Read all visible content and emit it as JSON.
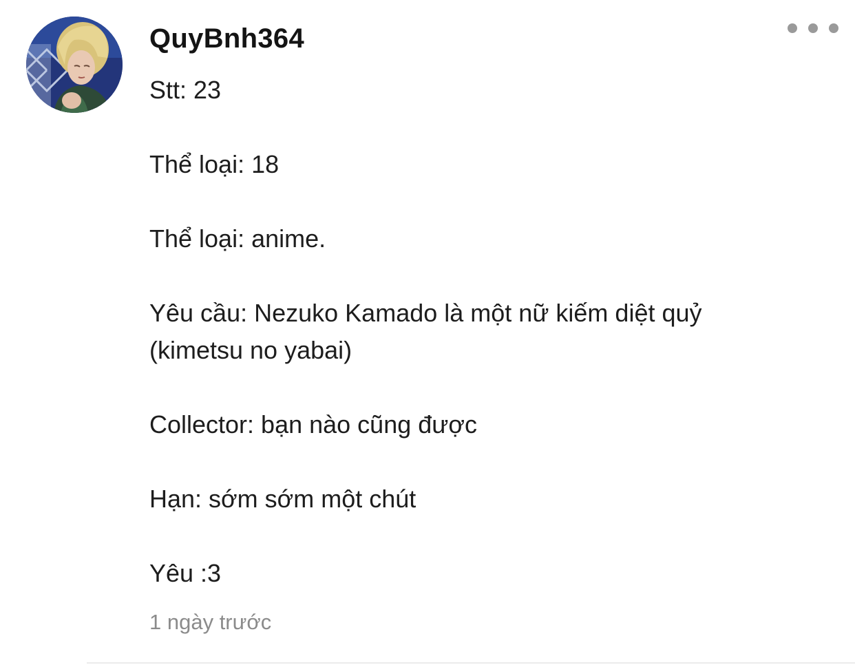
{
  "comment": {
    "username": "QuyBnh364",
    "avatar_icon": "user-avatar-anime-girl",
    "more_icon": "more-options-icon",
    "lines": [
      "Stt: 23",
      "Thể loại: 18",
      "Thể loại: anime.",
      "Yêu cầu: Nezuko Kamado là một nữ kiếm diệt quỷ",
      "(kimetsu no yabai)",
      "Collector: bạn nào cũng được",
      "Hạn: sớm sớm một chút",
      "Yêu :3"
    ],
    "timestamp": "1 ngày trước"
  }
}
